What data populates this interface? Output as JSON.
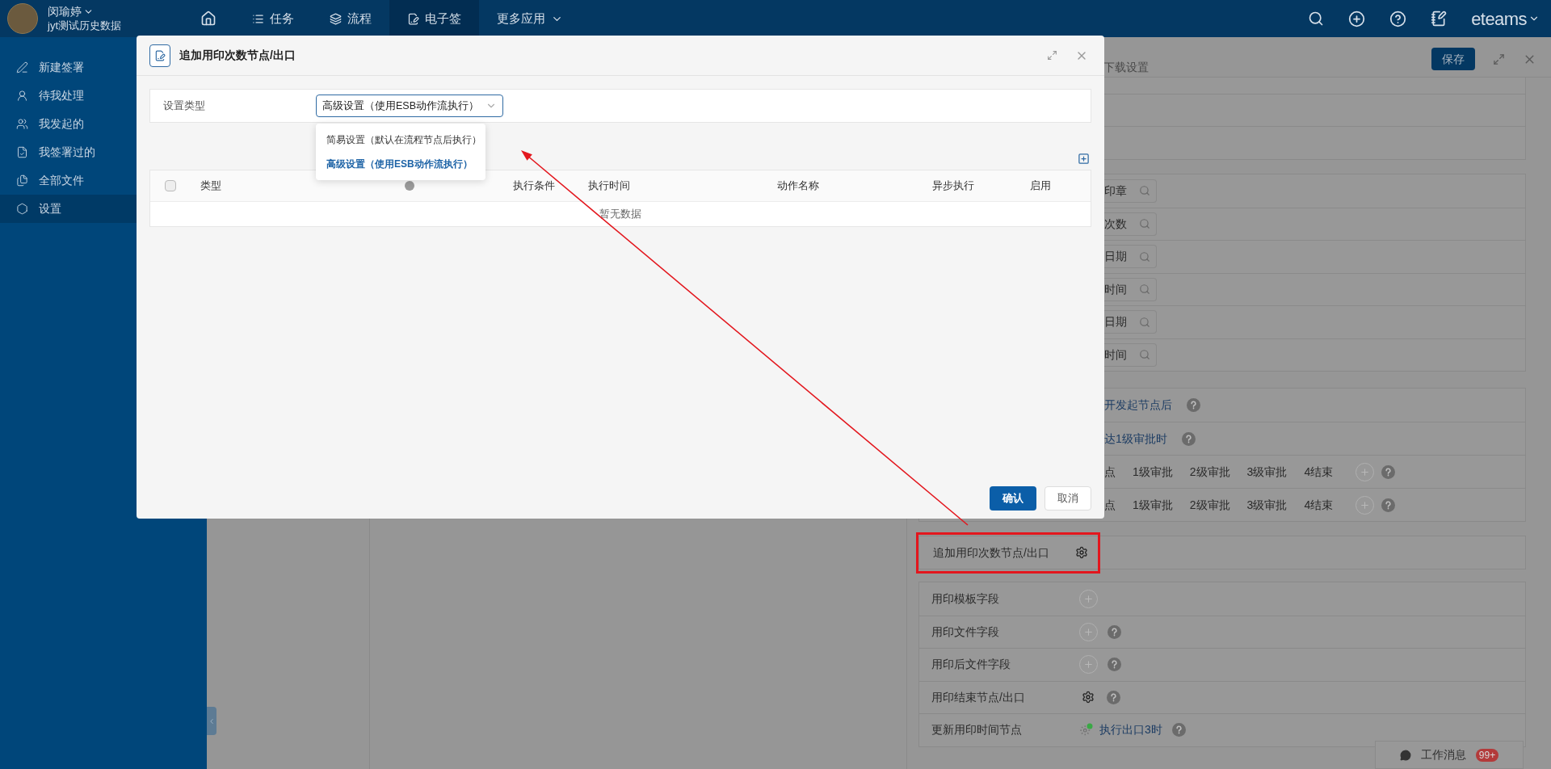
{
  "user": {
    "name": "闵瑜婷",
    "org": "jyt测试历史数据"
  },
  "nav": [
    {
      "kind": "home",
      "selected": false
    },
    {
      "kind": "tasks",
      "label": "任务",
      "selected": false
    },
    {
      "kind": "flow",
      "label": "流程",
      "selected": false
    },
    {
      "kind": "sign",
      "label": "电子签",
      "selected": true
    },
    {
      "kind": "more",
      "label": "更多应用",
      "selected": false
    }
  ],
  "brand": "eteams",
  "sidebar": {
    "items": [
      {
        "label": "新建签署",
        "selected": false
      },
      {
        "label": "待我处理",
        "selected": false
      },
      {
        "label": "我发起的",
        "selected": false
      },
      {
        "label": "我签署过的",
        "selected": false
      },
      {
        "label": "全部文件",
        "selected": false
      },
      {
        "label": "设置",
        "selected": true
      }
    ]
  },
  "panel": {
    "tab": "下载设置",
    "save_button": "保存",
    "search_fields": [
      "印章",
      "次数",
      "日期",
      "时间",
      "日期",
      "时间"
    ],
    "trigger_rows": [
      {
        "kind": "link",
        "text": "开发起节点后",
        "help": true
      },
      {
        "kind": "link",
        "text": "达1级审批时",
        "help": true
      },
      {
        "kind": "chain",
        "nodes": [
          "点",
          "1级审批",
          "2级审批",
          "3级审批",
          "4结束"
        ],
        "help": true
      },
      {
        "kind": "chain",
        "nodes": [
          "点",
          "1级审批",
          "2级审批",
          "3级审批",
          "4结束"
        ],
        "help": true
      }
    ],
    "highlight": {
      "label": "追加用印次数节点/出口",
      "highlighted": true
    },
    "field_rows": [
      {
        "kind": "add",
        "label": "用印模板字段",
        "help": false
      },
      {
        "kind": "add",
        "label": "用印文件字段",
        "help": true
      },
      {
        "kind": "add",
        "label": "用印后文件字段",
        "help": true
      },
      {
        "kind": "settings",
        "label": "用印结束节点/出口",
        "help": true
      },
      {
        "kind": "status",
        "label": "更新用印时间节点",
        "value": "执行出口3时",
        "help": true
      }
    ]
  },
  "chat": {
    "label": "工作消息",
    "badge": "99+"
  },
  "modal": {
    "title": "追加用印次数节点/出口",
    "setting_label": "设置类型",
    "select_value": "高级设置（使用ESB动作流执行）",
    "options": [
      {
        "label": "简易设置（默认在流程节点后执行）",
        "selected": false
      },
      {
        "label": "高级设置（使用ESB动作流执行）",
        "selected": true
      }
    ],
    "select_all_checked": false,
    "columns": [
      {
        "label": "类型"
      },
      {
        "help": true
      },
      {
        "label": "执行条件"
      },
      {
        "label": "执行时间"
      },
      {
        "label": "动作名称"
      },
      {
        "label": "异步执行"
      },
      {
        "label": "启用"
      }
    ],
    "empty_text": "暂无数据",
    "confirm": "确认",
    "cancel": "取消"
  }
}
